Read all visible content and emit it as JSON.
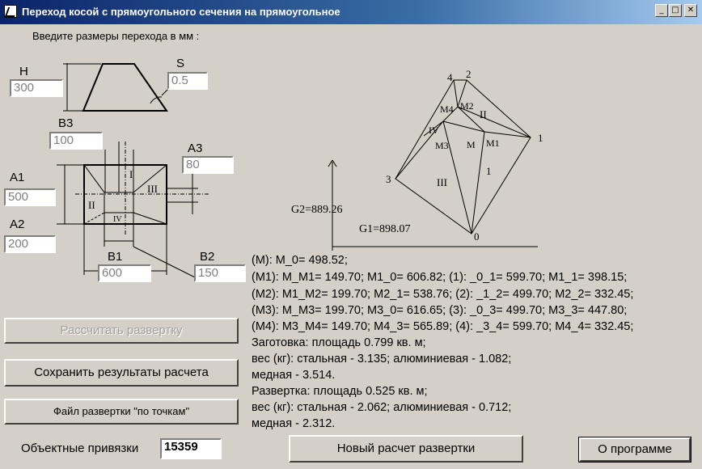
{
  "window": {
    "title": "Переход косой с прямоугольного сечения на прямоугольное",
    "min_glyph": "_",
    "max_glyph": "□",
    "close_glyph": "✕"
  },
  "prompt": "Введите размеры перехода в мм :",
  "inputs": {
    "H": {
      "label": "H",
      "value": "300"
    },
    "S": {
      "label": "S",
      "value": "0.5"
    },
    "B3": {
      "label": "B3",
      "value": "100"
    },
    "A3": {
      "label": "A3",
      "value": "80"
    },
    "A1": {
      "label": "A1",
      "value": "500"
    },
    "A2": {
      "label": "A2",
      "value": "200"
    },
    "B1": {
      "label": "B1",
      "value": "600"
    },
    "B2": {
      "label": "B2",
      "value": "150"
    }
  },
  "scheme_labels": {
    "I": "I",
    "II": "II",
    "III": "III",
    "IV": "IV"
  },
  "unfold": {
    "points": {
      "p0": "0",
      "p1": "1",
      "p2": "2",
      "p3": "3",
      "p4": "4"
    },
    "regions": {
      "M": "M",
      "M1": "M1",
      "M2": "M2",
      "M3": "M3",
      "M4": "M4",
      "r1": "1",
      "rII": "II",
      "rIII": "III",
      "rIV": "IV"
    },
    "G1": "G1=898.07",
    "G2": "G2=889.26"
  },
  "results": [
    "(M): M_0= 498.52;",
    "(M1): M_M1= 149.70; M1_0= 606.82; (1): _0_1= 599.70; M1_1= 398.15;",
    "(M2): M1_M2= 199.70; M2_1= 538.76; (2): _1_2= 499.70; M2_2= 332.45;",
    "(M3): M_M3= 199.70; M3_0= 616.65; (3): _0_3= 499.70; M3_3= 447.80;",
    "(M4): M3_M4= 149.70; M4_3= 565.89; (4): _3_4= 599.70; M4_4= 332.45;",
    "Заготовка: площадь 0.799 кв. м;",
    "вес (кг): стальная - 3.135; алюминиевая - 1.082;",
    "медная - 3.514.",
    "Развертка: площадь 0.525 кв. м;",
    "вес (кг): стальная - 2.062; алюминиевая - 0.712;",
    "медная - 2.312."
  ],
  "buttons": {
    "calculate": "Рассчитать развертку",
    "save": "Сохранить результаты расчета",
    "points_file": "Файл развертки \"по точкам\"",
    "new_calc": "Новый расчет развертки",
    "about": "О программе"
  },
  "snaps": {
    "label": "Объектные привязки",
    "value": "15359"
  }
}
